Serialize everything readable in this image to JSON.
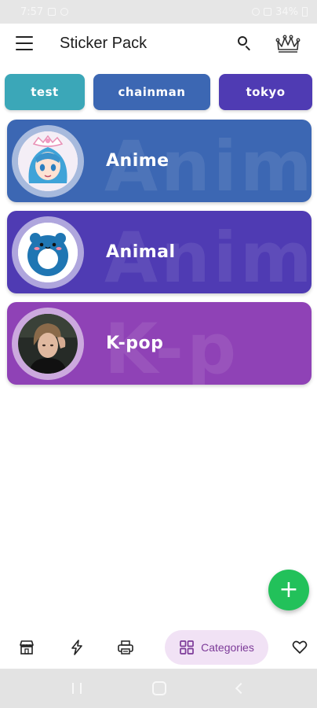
{
  "status_bar": {
    "time": "7:57",
    "battery": "34%"
  },
  "app_bar": {
    "title": "Sticker Pack"
  },
  "tags": [
    {
      "label": "test",
      "color": "#3ba7b8"
    },
    {
      "label": "chainman",
      "color": "#3c67b3"
    },
    {
      "label": "tokyo",
      "color": "#4f3bb3"
    }
  ],
  "categories": [
    {
      "label": "Anime",
      "ghost": "Anim",
      "color": "#3c67b3"
    },
    {
      "label": "Animal",
      "ghost": "Anim",
      "color": "#4f3bb3"
    },
    {
      "label": "K-pop",
      "ghost": "K-p",
      "color": "#8f42b6"
    }
  ],
  "fab": {
    "label": "+",
    "color": "#22c15a"
  },
  "bottom_nav": {
    "items": [
      {
        "icon": "store-icon"
      },
      {
        "icon": "lightning-icon"
      },
      {
        "icon": "printer-icon"
      },
      {
        "icon": "grid-icon",
        "label": "Categories",
        "active": true
      },
      {
        "icon": "heart-icon"
      }
    ],
    "active_bg": "#f1e2f5",
    "active_fg": "#7c3a98"
  }
}
